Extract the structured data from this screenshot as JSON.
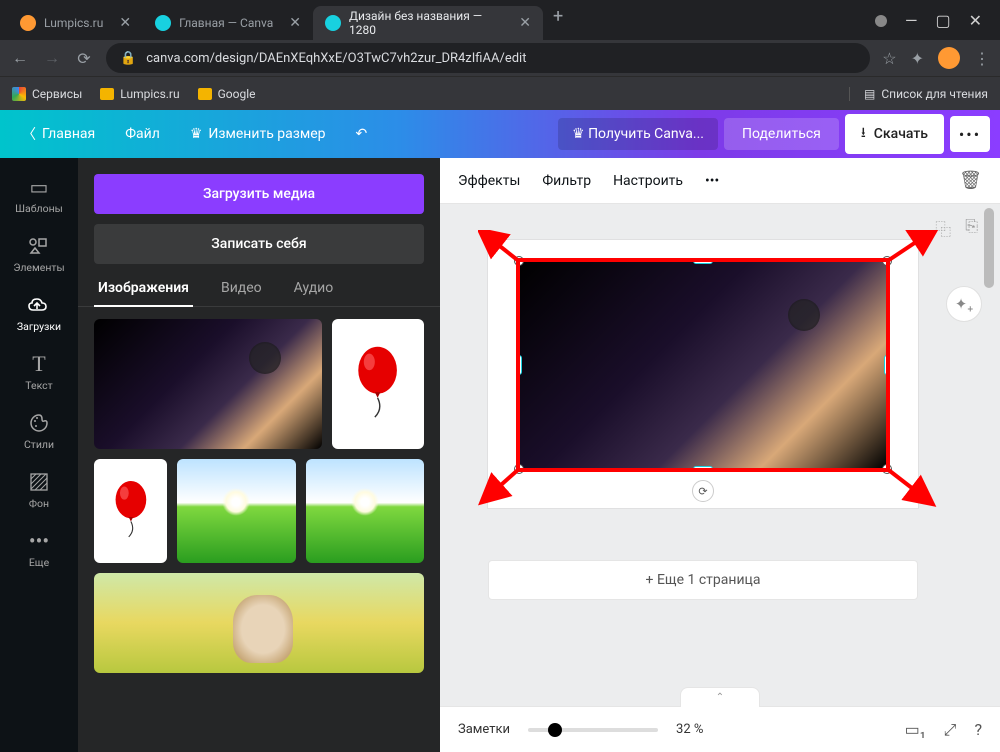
{
  "browser": {
    "tabs": [
      {
        "title": "Lumpics.ru",
        "fav": "#ff9933"
      },
      {
        "title": "Главная — Canva",
        "fav": "#18d1e0"
      },
      {
        "title": "Дизайн без названия — 1280",
        "fav": "#18d1e0"
      }
    ],
    "url": "canva.com/design/DAEnXEqhXxE/O3TwC7vh2zur_DR4zIfiAA/edit",
    "bookmarks": [
      "Сервисы",
      "Lumpics.ru",
      "Google"
    ],
    "readlist": "Список для чтения"
  },
  "canva": {
    "home": "Главная",
    "file": "Файл",
    "resize": "Изменить размер",
    "getpro": "Получить Canva...",
    "share": "Поделиться",
    "download": "Скачать"
  },
  "rail": [
    {
      "icon": "▭",
      "label": "Шаблоны"
    },
    {
      "icon": "♡△",
      "label": "Элементы"
    },
    {
      "icon": "☁",
      "label": "Загрузки"
    },
    {
      "icon": "T",
      "label": "Текст"
    },
    {
      "icon": "◐",
      "label": "Стили"
    },
    {
      "icon": "▨",
      "label": "Фон"
    },
    {
      "icon": "⋯",
      "label": "Еще"
    }
  ],
  "panel": {
    "upload": "Загрузить медиа",
    "record": "Записать себя",
    "tabs": [
      "Изображения",
      "Видео",
      "Аудио"
    ]
  },
  "toolbar": {
    "effects": "Эффекты",
    "filter": "Фильтр",
    "adjust": "Настроить"
  },
  "addpage": "+ Еще 1 страница",
  "bottom": {
    "notes": "Заметки",
    "zoom": "32 %"
  }
}
